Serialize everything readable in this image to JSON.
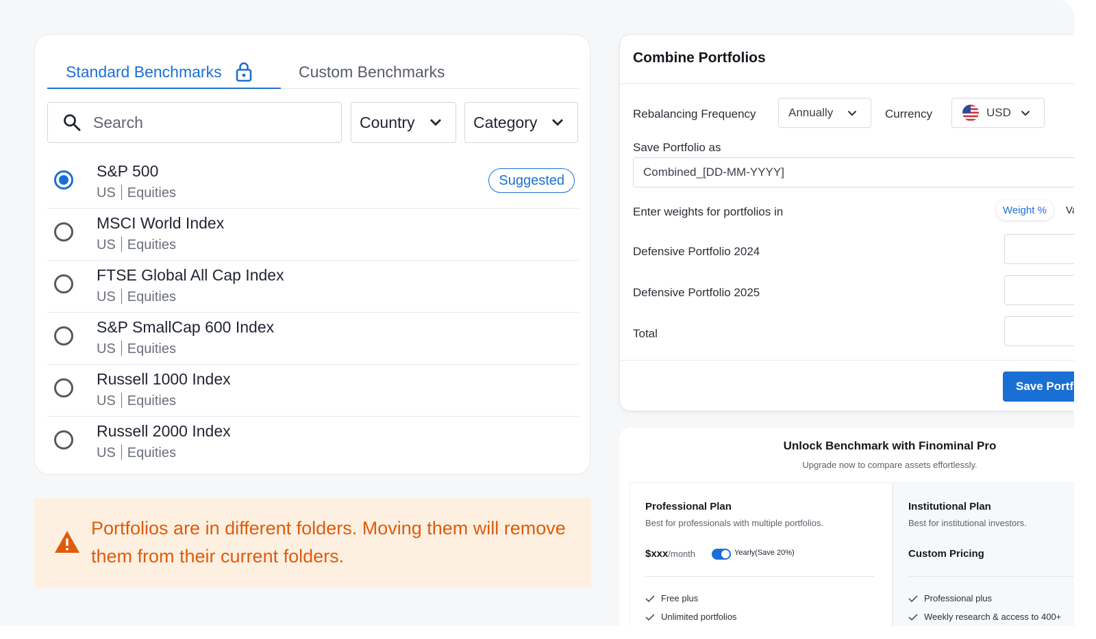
{
  "benchmarks": {
    "tabs": [
      {
        "label": "Standard Benchmarks"
      },
      {
        "label": "Custom Benchmarks"
      }
    ],
    "search": {
      "placeholder": "Search",
      "value": ""
    },
    "filters": {
      "country": "Country",
      "category": "Category"
    },
    "items": [
      {
        "name": "S&P 500",
        "country": "US",
        "asset": "Equities",
        "badge": "Suggested"
      },
      {
        "name": "MSCI World Index",
        "country": "US",
        "asset": "Equities"
      },
      {
        "name": "FTSE Global All Cap Index",
        "country": "US",
        "asset": "Equities"
      },
      {
        "name": "S&P SmallCap 600 Index",
        "country": "US",
        "asset": "Equities"
      },
      {
        "name": "Russell 1000 Index",
        "country": "US",
        "asset": "Equities"
      },
      {
        "name": "Russell 2000 Index",
        "country": "US",
        "asset": "Equities"
      }
    ],
    "selected_index": 0
  },
  "warning": {
    "text": "Portfolios are in different folders. Moving them will remove them from their current folders."
  },
  "combine": {
    "title": "Combine Portfolios",
    "rebalancing_label": "Rebalancing Frequency",
    "rebalancing_value": "Annually",
    "currency_label": "Currency",
    "currency_value": "USD",
    "save_as_label": "Save Portfolio as",
    "save_as_value": "Combined_[DD-MM-YYYY]",
    "weights_label": "Enter weights for portfolios in",
    "toggle_weight": "Weight %",
    "toggle_value": "Va",
    "rows": [
      {
        "label": "Defensive Portfolio 2024"
      },
      {
        "label": "Defensive Portfolio 2025"
      },
      {
        "label": "Total"
      }
    ],
    "save_button": "Save Portf"
  },
  "upsell": {
    "title": "Unlock Benchmark with Finominal Pro",
    "subtitle": "Upgrade now to compare assets effortlessly.",
    "pro": {
      "name": "Professional Plan",
      "desc": "Best for professionals with multiple portfolios.",
      "price": "$xxx",
      "unit": "/month",
      "toggle_label": "Yearly(Save 20%)",
      "features": [
        "Free plus",
        "Unlimited portfolios"
      ]
    },
    "inst": {
      "name": "Institutional Plan",
      "desc": "Best for institutional investors.",
      "price": "Custom Pricing",
      "features": [
        "Professional plus",
        "Weekly research & access to 400+"
      ]
    }
  },
  "colors": {
    "accent": "#1a6fd4",
    "warning": "#e05a0a",
    "warning_bg": "#fdf0e1"
  }
}
